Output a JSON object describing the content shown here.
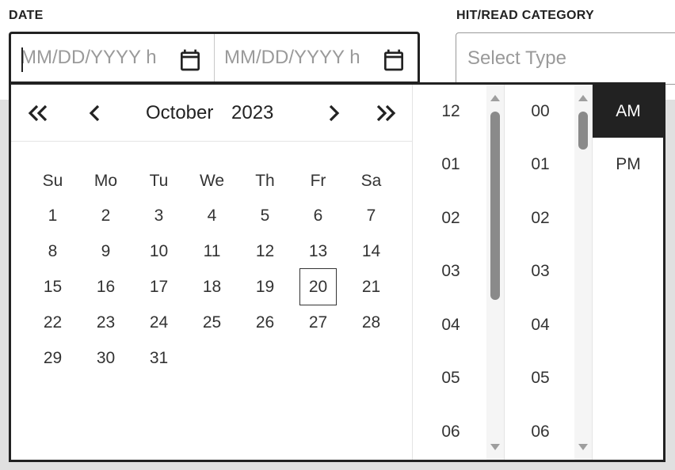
{
  "labels": {
    "date": "DATE",
    "category": "HIT/READ CATEGORY"
  },
  "date_range": {
    "start": {
      "placeholder": "MM/DD/YYYY h",
      "value": ""
    },
    "end": {
      "placeholder": "MM/DD/YYYY h",
      "value": ""
    }
  },
  "category_select": {
    "placeholder": "Select Type"
  },
  "calendar": {
    "month": "October",
    "year": "2023",
    "weekdays": [
      "Su",
      "Mo",
      "Tu",
      "We",
      "Th",
      "Fr",
      "Sa"
    ],
    "days": [
      "1",
      "2",
      "3",
      "4",
      "5",
      "6",
      "7",
      "8",
      "9",
      "10",
      "11",
      "12",
      "13",
      "14",
      "15",
      "16",
      "17",
      "18",
      "19",
      "20",
      "21",
      "22",
      "23",
      "24",
      "25",
      "26",
      "27",
      "28",
      "29",
      "30",
      "31"
    ],
    "selected_day": "20"
  },
  "time": {
    "hours": [
      "12",
      "01",
      "02",
      "03",
      "04",
      "05",
      "06"
    ],
    "minutes": [
      "00",
      "01",
      "02",
      "03",
      "04",
      "05",
      "06"
    ],
    "ampm": [
      "AM",
      "PM"
    ],
    "selected_ampm": "AM"
  },
  "icons": {
    "calendar": "calendar-icon",
    "prev_year": "double-chevron-left-icon",
    "prev_month": "chevron-left-icon",
    "next_month": "chevron-right-icon",
    "next_year": "double-chevron-right-icon"
  },
  "colors": {
    "selected_bg": "#222222",
    "page_bg": "#e0e0e0"
  }
}
